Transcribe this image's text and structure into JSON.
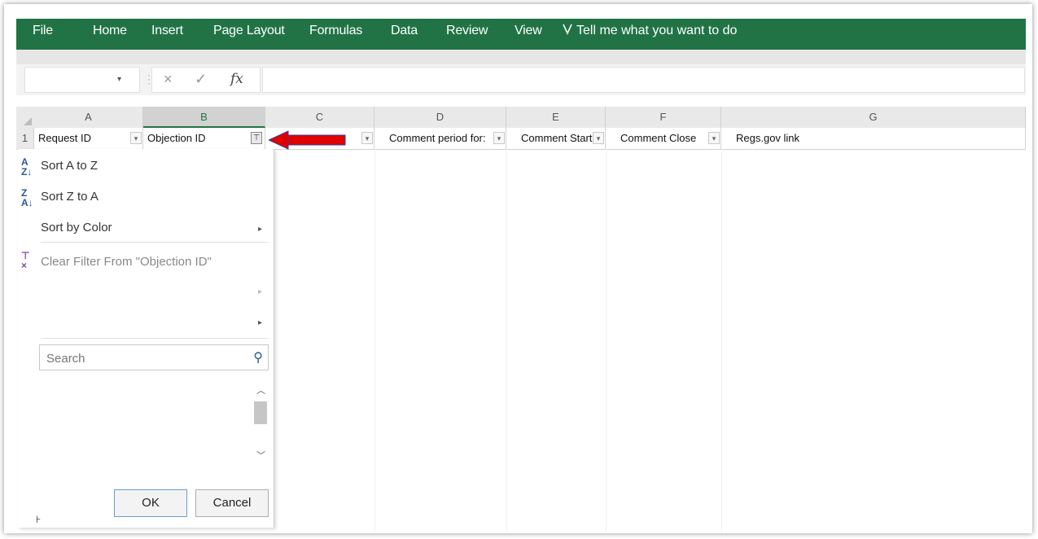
{
  "ribbon": {
    "tabs": [
      "File",
      "Home",
      "Insert",
      "Page Layout",
      "Formulas",
      "Data",
      "Review",
      "View"
    ],
    "tell_me": "Tell me what you want to do",
    "bulb_icon": "lightbulb-icon"
  },
  "formula_bar": {
    "name_box_value": "",
    "cancel_glyph": "×",
    "enter_glyph": "✓",
    "fx_glyph": "fx",
    "formula_value": ""
  },
  "columns": [
    "A",
    "B",
    "C",
    "D",
    "E",
    "F",
    "G"
  ],
  "selected_column": "B",
  "row1": {
    "row_number": "1",
    "cells": [
      "Request ID",
      "Objection ID",
      "",
      "Comment period for:",
      "Comment Start",
      "Comment Close",
      "Regs.gov link"
    ]
  },
  "filter_menu": {
    "sort_az": "Sort A to Z",
    "sort_za": "Sort Z to A",
    "sort_by_color": "Sort by Color",
    "clear_filter": "Clear Filter From \"Objection ID\"",
    "search_placeholder": "Search",
    "ok": "OK",
    "cancel": "Cancel"
  },
  "colors": {
    "ribbon": "#217346",
    "arrow": "#e00000"
  }
}
